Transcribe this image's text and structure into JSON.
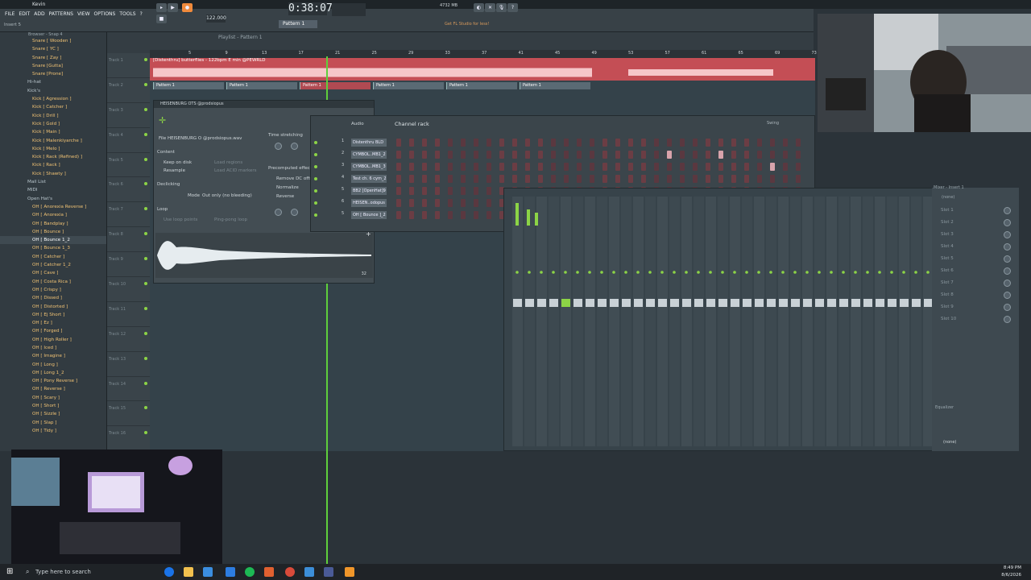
{
  "window": {
    "title": "Kevin"
  },
  "menu": [
    "FILE",
    "EDIT",
    "ADD",
    "PATTERNS",
    "VIEW",
    "OPTIONS",
    "TOOLS",
    "?"
  ],
  "toolbar": {
    "time": "0:38:07",
    "tempo": "122.000",
    "pattern": "Pattern 1",
    "hint_label": "Insert 5",
    "promo": "Get FL Studio for less!",
    "memory": "4732 MB"
  },
  "browser": {
    "header": "Browser - Snap 4",
    "items": [
      {
        "label": "Snare [ Wooden ]",
        "kind": "file"
      },
      {
        "label": "Snare [ YC ]",
        "kind": "file"
      },
      {
        "label": "Snare [ Zay ]",
        "kind": "file"
      },
      {
        "label": "Snare [Gutta]",
        "kind": "file"
      },
      {
        "label": "Snare [Prone]",
        "kind": "file"
      },
      {
        "label": "Hi-hat",
        "kind": "folder"
      },
      {
        "label": "Kick's",
        "kind": "folder"
      },
      {
        "label": "Kick [ Agression ]",
        "kind": "file"
      },
      {
        "label": "Kick [ Catcher ]",
        "kind": "file"
      },
      {
        "label": "Kick [ Drill ]",
        "kind": "file"
      },
      {
        "label": "Kick [ Gold ]",
        "kind": "file"
      },
      {
        "label": "Kick [ Main ]",
        "kind": "file"
      },
      {
        "label": "Kick [ Malenkiyarche ]",
        "kind": "file"
      },
      {
        "label": "Kick [ Melo ]",
        "kind": "file"
      },
      {
        "label": "Kick [ Rack (Refined) ]",
        "kind": "file"
      },
      {
        "label": "Kick [ Rack ]",
        "kind": "file"
      },
      {
        "label": "Kick [ Shawty ]",
        "kind": "file"
      },
      {
        "label": "Mail List",
        "kind": "folder"
      },
      {
        "label": "MIDI",
        "kind": "folder"
      },
      {
        "label": "Open Hat's",
        "kind": "folder"
      },
      {
        "label": "OH [ Anorexia Reverse ]",
        "kind": "file"
      },
      {
        "label": "OH [ Anorexia ]",
        "kind": "file"
      },
      {
        "label": "OH [ Bandplay ]",
        "kind": "file"
      },
      {
        "label": "OH [ Bounce ]",
        "kind": "file"
      },
      {
        "label": "OH [ Bounce 1_2",
        "kind": "selected"
      },
      {
        "label": "OH [ Bounce 1_3",
        "kind": "file"
      },
      {
        "label": "OH [ Catcher ]",
        "kind": "file"
      },
      {
        "label": "OH [ Catcher 1_2",
        "kind": "file"
      },
      {
        "label": "OH [ Cave ]",
        "kind": "file"
      },
      {
        "label": "OH [ Costa Rica ]",
        "kind": "file"
      },
      {
        "label": "OH [ Crispy ]",
        "kind": "file"
      },
      {
        "label": "OH [ Dissed ]",
        "kind": "file"
      },
      {
        "label": "OH [ Distorted ]",
        "kind": "file"
      },
      {
        "label": "OH [ Ej Short ]",
        "kind": "file"
      },
      {
        "label": "OH [ Ez ]",
        "kind": "file"
      },
      {
        "label": "OH [ Forged ]",
        "kind": "file"
      },
      {
        "label": "OH [ High Roller ]",
        "kind": "file"
      },
      {
        "label": "OH [ Iced ]",
        "kind": "file"
      },
      {
        "label": "OH [ Imagine ]",
        "kind": "file"
      },
      {
        "label": "OH [ Long ]",
        "kind": "file"
      },
      {
        "label": "OH [ Long 1_2",
        "kind": "file"
      },
      {
        "label": "OH [ Pony Reverse ]",
        "kind": "file"
      },
      {
        "label": "OH [ Reverse ]",
        "kind": "file"
      },
      {
        "label": "OH [ Scary ]",
        "kind": "file"
      },
      {
        "label": "OH [ Short ]",
        "kind": "file"
      },
      {
        "label": "OH [ Sizzle ]",
        "kind": "file"
      },
      {
        "label": "OH [ Slap ]",
        "kind": "file"
      },
      {
        "label": "OH [ Tidy ]",
        "kind": "file"
      }
    ]
  },
  "playlist": {
    "title": "Playlist - Pattern 1",
    "tracks": [
      "Track 1",
      "Track 2",
      "Track 3",
      "Track 4",
      "Track 5",
      "Track 6",
      "Track 7",
      "Track 8",
      "Track 9",
      "Track 10",
      "Track 11",
      "Track 12",
      "Track 13",
      "Track 14",
      "Track 15",
      "Track 16"
    ],
    "ruler": [
      "5",
      "9",
      "13",
      "17",
      "21",
      "25",
      "29",
      "33",
      "37",
      "41",
      "45",
      "49",
      "53",
      "57",
      "61",
      "65",
      "69",
      "73"
    ],
    "audio_clip": "[Distenthru] butterflies - 122bpm E min @PEWRLD",
    "pattern_clips": [
      "Pattern 1",
      "Pattern 1",
      "Pattern 1",
      "Pattern 1",
      "Pattern 1",
      "Pattern 1"
    ]
  },
  "sampler": {
    "title": "HEISENBURG OTS @prodsiopus",
    "file": "File HEISENBURG O @prodsiopus.wav",
    "content": "Content",
    "keep_on_disk": "Keep on disk",
    "resample": "Resample",
    "load_regions": "Load regions",
    "load_acid": "Load ACID markers",
    "time_stretching": "Time stretching",
    "precomputed": "Precomputed effects",
    "remove_dc": "Remove DC offset",
    "normalize": "Normalize",
    "reverse": "Reverse",
    "declicking": "Declicking",
    "mode_label": "Mode",
    "mode_value": "Out only (no bleeding)",
    "loop": "Loop",
    "use_loop": "Use loop points",
    "ping_pong": "Ping-pong loop",
    "length": "32"
  },
  "channel_rack": {
    "title": "Channel rack",
    "filter": "Audio",
    "swing_label": "Swing",
    "add_button": "+",
    "channels": [
      {
        "num": "1",
        "name": "Distenthru BLD"
      },
      {
        "num": "2",
        "name": "CYMBOL..MB1_2"
      },
      {
        "num": "3",
        "name": "CYMBOL..MB1_3"
      },
      {
        "num": "4",
        "name": "Test ch. 6 cym_2"
      },
      {
        "num": "5",
        "name": "BB2 [OpenHat]9"
      },
      {
        "num": "6",
        "name": "HEISEN..odopus"
      },
      {
        "num": "5",
        "name": "OH [ Bounce ]_2"
      }
    ],
    "steps_on": {
      "1": [],
      "2": [
        21,
        25
      ],
      "3": [
        29
      ],
      "4": [],
      "5": [],
      "6": [
        14
      ],
      "7": [
        14
      ]
    },
    "step_count": 32
  },
  "mixer": {
    "title": "Mixer - Insert 1",
    "preset": "(none)",
    "slots": [
      "Slot 1",
      "Slot 2",
      "Slot 3",
      "Slot 4",
      "Slot 5",
      "Slot 6",
      "Slot 7",
      "Slot 8",
      "Slot 9",
      "Slot 10"
    ],
    "equalizer": "Equalizer",
    "none": "(none)"
  },
  "taskbar": {
    "search": "Type here to search",
    "time": "8:49 PM",
    "date": "8/6/2026"
  },
  "colors": {
    "accent": "#8cd446",
    "clip": "#c44e55",
    "step_on": "#d8a3ab",
    "step_off": "#6b3d44"
  }
}
